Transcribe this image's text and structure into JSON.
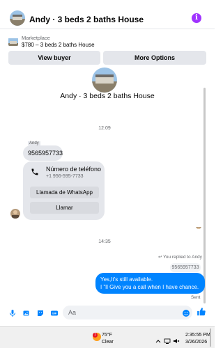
{
  "header": {
    "title": "Andy · 3 beds 2 baths House",
    "info_icon": "info-icon"
  },
  "marketplace": {
    "label": "Marketplace",
    "listing": "$780 – 3 beds 2 baths House",
    "view_buyer_label": "View buyer",
    "more_options_label": "More Options"
  },
  "chat": {
    "title": "Andy · 3 beds 2 baths House",
    "timestamp_1": "12:09",
    "sender_tag": "Andy",
    "incoming_text": "9565957733",
    "card": {
      "title": "Número de teléfono",
      "subtitle": "+1 956-595-7733",
      "whatsapp_label": "Llamada de WhatsApp",
      "call_label": "Llamar"
    },
    "timestamp_2": "14:35",
    "replied_label": "You replied to Andy",
    "replied_quote": "9565957733",
    "outgoing_line1": "Yes,It's still available.",
    "outgoing_line2": "I \"ll Give you a call when I have chance.",
    "sent_label": "Sent"
  },
  "composer": {
    "placeholder": "Aa",
    "icons": [
      "microphone-icon",
      "gallery-icon",
      "sticker-icon",
      "gif-icon",
      "emoji-icon",
      "like-icon"
    ]
  },
  "taskbar": {
    "temperature": "75°F",
    "condition": "Clear",
    "weather_badge": "1",
    "time": "2:35:55 PM",
    "date": "3/26/2026"
  },
  "colors": {
    "accent": "#0084ff",
    "info": "#a033ff",
    "bubble_gray": "#e4e6eb"
  }
}
